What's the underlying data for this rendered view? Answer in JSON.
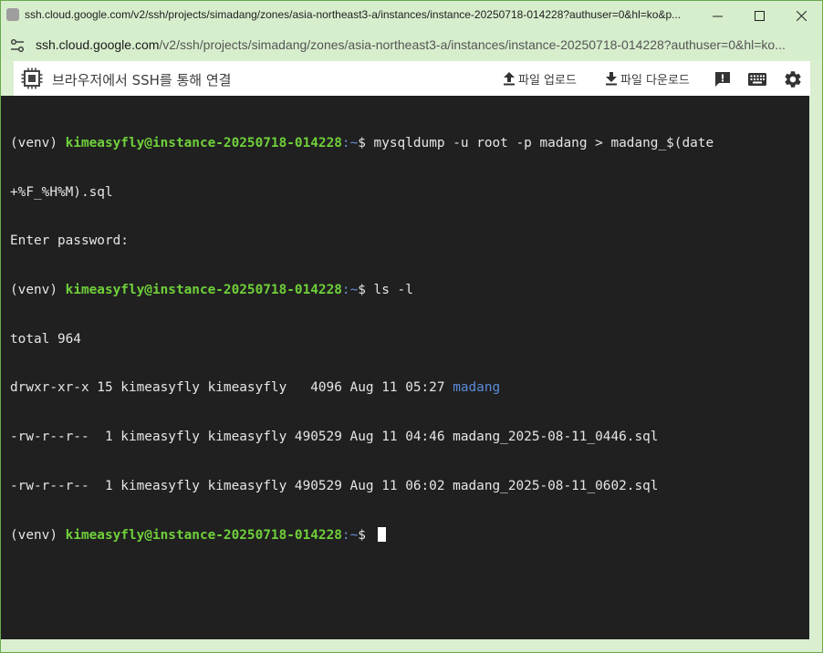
{
  "titlebar": {
    "title": "ssh.cloud.google.com/v2/ssh/projects/simadang/zones/asia-northeast3-a/instances/instance-20250718-014228?authuser=0&hl=ko&p..."
  },
  "addressbar": {
    "host": "ssh.cloud.google.com",
    "path": "/v2/ssh/projects/simadang/zones/asia-northeast3-a/instances/instance-20250718-014228?authuser=0&hl=ko..."
  },
  "sshbar": {
    "title": "브라우저에서 SSH를 통해 연결",
    "upload_label": "파일 업로드",
    "download_label": "파일 다운로드"
  },
  "terminal": {
    "lines": [
      {
        "venv": "(venv) ",
        "user": "kimeasyfly@instance-20250718-014228",
        "path": ":~",
        "cmd": "$ mysqldump -u root -p madang > madang_$(date"
      },
      {
        "text": "+%F_%H%M).sql"
      },
      {
        "text": "Enter password:"
      },
      {
        "venv": "(venv) ",
        "user": "kimeasyfly@instance-20250718-014228",
        "path": ":~",
        "cmd": "$ ls -l"
      },
      {
        "text": "total 964"
      },
      {
        "text": "drwxr-xr-x 15 kimeasyfly kimeasyfly   4096 Aug 11 05:27 ",
        "dir": "madang"
      },
      {
        "text": "-rw-r--r--  1 kimeasyfly kimeasyfly 490529 Aug 11 04:46 madang_2025-08-11_0446.sql"
      },
      {
        "text": "-rw-r--r--  1 kimeasyfly kimeasyfly 490529 Aug 11 06:02 madang_2025-08-11_0602.sql"
      },
      {
        "venv": "(venv) ",
        "user": "kimeasyfly@instance-20250718-014228",
        "path": ":~",
        "cmd": "$ "
      }
    ]
  },
  "icons": {
    "title": "page-icon",
    "address": "site-settings-icon",
    "chip": "compute-chip-icon",
    "upload": "upload-arrow-icon",
    "download": "download-arrow-icon",
    "feedback": "feedback-icon",
    "keyboard": "keyboard-icon",
    "settings": "gear-icon"
  },
  "colors": {
    "window_tint": "#d9efcf",
    "terminal_bg": "#202020",
    "prompt_user": "#6fd03a",
    "prompt_path": "#6a8fd6"
  }
}
